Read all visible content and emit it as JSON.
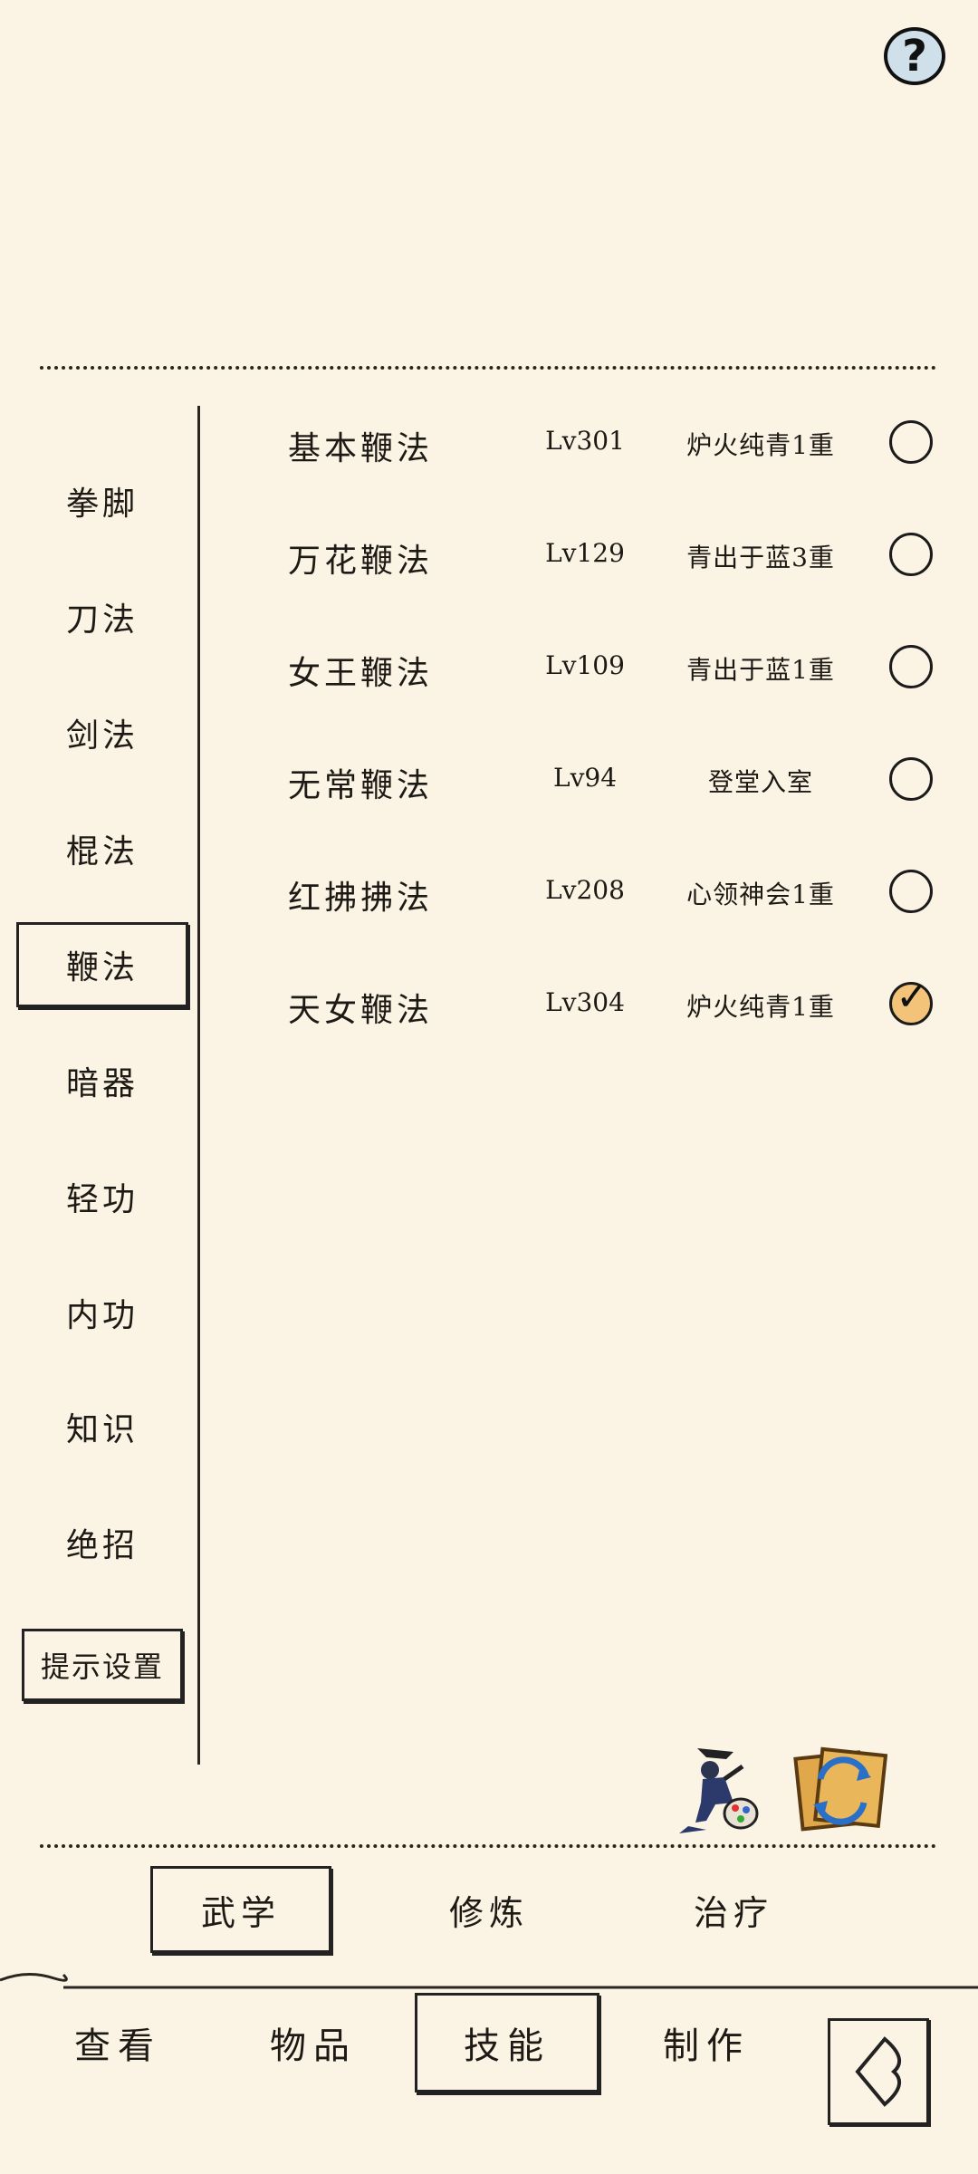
{
  "header": {
    "help_label": "?"
  },
  "categories": [
    {
      "label": "拳脚"
    },
    {
      "label": "刀法"
    },
    {
      "label": "剑法"
    },
    {
      "label": "棍法"
    },
    {
      "label": "鞭法"
    },
    {
      "label": "暗器"
    },
    {
      "label": "轻功"
    },
    {
      "label": "内功"
    },
    {
      "label": "知识"
    },
    {
      "label": "绝招"
    }
  ],
  "active_category": "鞭法",
  "hint_settings_label": "提示设置",
  "skills": [
    {
      "name": "基本鞭法",
      "level": "Lv301",
      "stage": "炉火纯青1重",
      "selected": false
    },
    {
      "name": "万花鞭法",
      "level": "Lv129",
      "stage": "青出于蓝3重",
      "selected": false
    },
    {
      "name": "女王鞭法",
      "level": "Lv109",
      "stage": "青出于蓝1重",
      "selected": false
    },
    {
      "name": "无常鞭法",
      "level": "Lv94",
      "stage": "登堂入室",
      "selected": false
    },
    {
      "name": "红拂拂法",
      "level": "Lv208",
      "stage": "心领神会1重",
      "selected": false
    },
    {
      "name": "天女鞭法",
      "level": "Lv304",
      "stage": "炉火纯青1重",
      "selected": true
    }
  ],
  "action_icons": [
    {
      "name": "ninja-palette-icon"
    },
    {
      "name": "scroll-swap-icon"
    }
  ],
  "sub_tabs": [
    {
      "label": "武学",
      "active": true
    },
    {
      "label": "修炼",
      "active": false
    },
    {
      "label": "治疗",
      "active": false
    }
  ],
  "bottom_nav": [
    {
      "label": "查看",
      "active": false
    },
    {
      "label": "物品",
      "active": false
    },
    {
      "label": "技能",
      "active": true
    },
    {
      "label": "制作",
      "active": false
    }
  ],
  "colors": {
    "background": "#fbf3e3",
    "ink": "#1d1a16",
    "check_on": "#f3c37a",
    "help_bg": "#cfe0ea"
  }
}
